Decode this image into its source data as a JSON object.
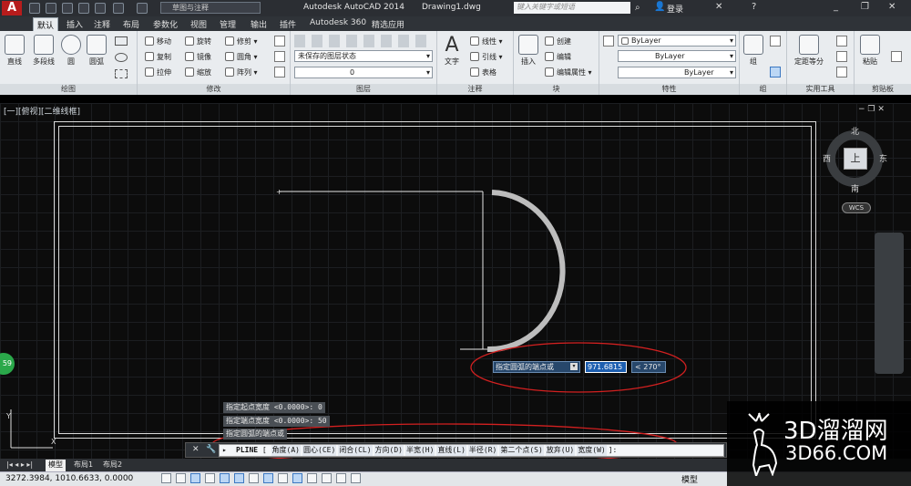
{
  "title_bar": {
    "workspace": "草图与注释",
    "app_title": "Autodesk AutoCAD 2014",
    "file_name": "Drawing1.dwg",
    "search_placeholder": "键入关键字或短语",
    "login": "登录"
  },
  "tabs": [
    "默认",
    "插入",
    "注释",
    "布局",
    "参数化",
    "视图",
    "管理",
    "输出",
    "插件",
    "Autodesk 360",
    "精选应用"
  ],
  "ribbon": {
    "draw": {
      "title": "绘图",
      "line": "直线",
      "polyline": "多段线",
      "circle": "圆",
      "arc": "圆弧"
    },
    "modify": {
      "title": "修改",
      "move": "移动",
      "rotate": "旋转",
      "trim": "修剪",
      "copy": "复制",
      "mirror": "镜像",
      "fillet": "圆角",
      "stretch": "拉伸",
      "scale": "缩放",
      "array": "阵列"
    },
    "layers": {
      "title": "图层",
      "layer_state": "未保存的图层状态",
      "layer_current": "0"
    },
    "annotation": {
      "title": "注释",
      "text": "文字",
      "linear": "线性",
      "leader": "引线",
      "table": "表格"
    },
    "block": {
      "title": "块",
      "insert": "插入",
      "create": "创建",
      "edit": "编辑",
      "edit_attr": "编辑属性"
    },
    "properties": {
      "title": "特性",
      "color": "ByLayer",
      "linetype": "ByLayer",
      "lineweight": "ByLayer"
    },
    "groups": {
      "title": "组",
      "group": "组"
    },
    "utilities": {
      "title": "实用工具",
      "measure": "定距等分"
    },
    "clipboard": {
      "title": "剪贴板",
      "paste": "粘贴"
    }
  },
  "viewport": {
    "label": "[一][俯视][二维线框]",
    "compass": {
      "n": "北",
      "s": "南",
      "e": "东",
      "w": "西",
      "top": "上"
    },
    "wcs": "WCS",
    "badge": "59"
  },
  "dynamic_input": {
    "prompt": "指定圆弧的端点或",
    "value": "971.6815",
    "angle": "< 270°"
  },
  "command": {
    "history": [
      "指定起点宽度 <0.0000>: 0",
      "指定端点宽度 <0.0000>: 50",
      "指定圆弧的端点或"
    ],
    "current": "PLINE",
    "options": [
      "角度(A)",
      "圆心(CE)",
      "闭合(CL)",
      "方向(D)",
      "半宽(H)",
      "直线(L)",
      "半径(R)",
      "第二个点(S)",
      "放弃(U)",
      "宽度(W)"
    ],
    "tail": "]:"
  },
  "layout_tabs": [
    "模型",
    "布局1",
    "布局2"
  ],
  "status": {
    "coords": "3272.3984, 1010.6633, 0.0000",
    "mode": "模型"
  },
  "watermark": {
    "name": "3D溜溜网",
    "url": "3D66.COM"
  },
  "colors": {
    "accent": "#1e5fb0",
    "ribbon": "#e9ecef",
    "canvas": "#0c0c0c",
    "annotation_red": "#d32020"
  }
}
